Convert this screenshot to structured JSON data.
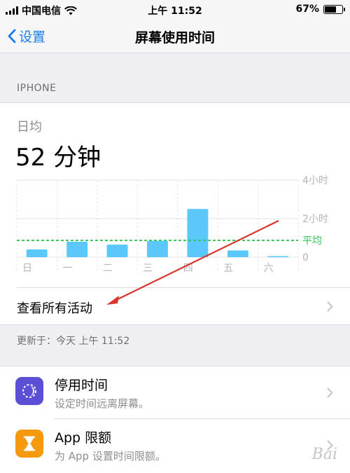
{
  "status_bar": {
    "carrier": "中国电信",
    "time": "上午 11:52",
    "battery": "67%",
    "battery_level": 0.67
  },
  "nav": {
    "back_label": "设置",
    "title": "屏幕使用时间"
  },
  "section_label": "IPHONE",
  "summary": {
    "avg_label": "日均",
    "avg_value": "52 分钟"
  },
  "chart_data": {
    "type": "bar",
    "categories": [
      "日",
      "一",
      "二",
      "三",
      "四",
      "五",
      "六"
    ],
    "values": [
      0.4,
      0.8,
      0.65,
      0.85,
      2.5,
      0.35,
      0.05
    ],
    "ylim": [
      0,
      4
    ],
    "y_tick_labels": [
      "4小时",
      "2小时",
      "0"
    ],
    "average": 0.87,
    "average_label": "平均",
    "bar_color": "#5ac8fa",
    "average_color": "#34c759",
    "grid": true
  },
  "view_all": {
    "label": "查看所有活动"
  },
  "updated": "更新于：今天 上午 11:52",
  "list": [
    {
      "title": "停用时间",
      "subtitle": "设定时间远离屏幕。",
      "icon": "downtime-icon",
      "icon_color": "#5b4fd6"
    },
    {
      "title": "App 限额",
      "subtitle": "为 App 设置时间限额。",
      "icon": "hourglass-icon",
      "icon_color": "#f59a0c"
    }
  ]
}
